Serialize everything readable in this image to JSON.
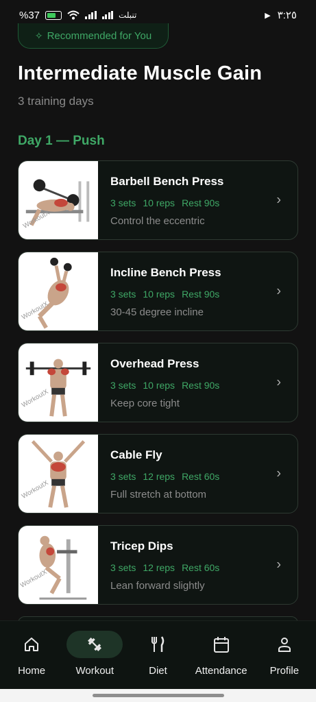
{
  "status_bar": {
    "battery_text": "%37",
    "carrier": "تنبلت",
    "time": "٣:٢٥"
  },
  "recommended": {
    "label": "Recommended for You",
    "icon": "sparkle-icon"
  },
  "header": {
    "title": "Intermediate Muscle Gain",
    "subtitle": "3 training days"
  },
  "day": {
    "heading": "Day 1 — Push"
  },
  "exercises": [
    {
      "name": "Barbell Bench Press",
      "sets": "3 sets",
      "reps": "10 reps",
      "rest": "Rest 90s",
      "note": "Control the eccentric"
    },
    {
      "name": "Incline Bench Press",
      "sets": "3 sets",
      "reps": "10 reps",
      "rest": "Rest 90s",
      "note": "30-45 degree incline"
    },
    {
      "name": "Overhead Press",
      "sets": "3 sets",
      "reps": "10 reps",
      "rest": "Rest 90s",
      "note": "Keep core tight"
    },
    {
      "name": "Cable Fly",
      "sets": "3 sets",
      "reps": "12 reps",
      "rest": "Rest 60s",
      "note": "Full stretch at bottom"
    },
    {
      "name": "Tricep Dips",
      "sets": "3 sets",
      "reps": "12 reps",
      "rest": "Rest 60s",
      "note": "Lean forward slightly"
    }
  ],
  "watermark": "WorkoutX",
  "nav": [
    {
      "label": "Home",
      "icon": "home-icon",
      "active": false
    },
    {
      "label": "Workout",
      "icon": "dumbbell-icon",
      "active": true
    },
    {
      "label": "Diet",
      "icon": "fork-knife-icon",
      "active": false
    },
    {
      "label": "Attendance",
      "icon": "calendar-icon",
      "active": false
    },
    {
      "label": "Profile",
      "icon": "person-icon",
      "active": false
    }
  ],
  "colors": {
    "accent": "#3fa866",
    "background": "#121212",
    "card": "#0f1512"
  }
}
